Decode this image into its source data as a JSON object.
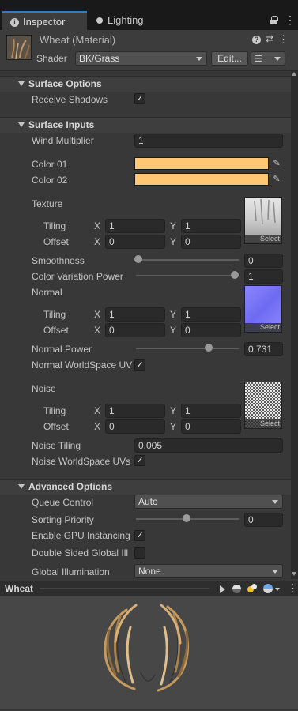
{
  "tabs": {
    "inspector": "Inspector",
    "lighting": "Lighting"
  },
  "header": {
    "title": "Wheat (Material)",
    "shader_label": "Shader",
    "shader_value": "BK/Grass",
    "edit_label": "Edit..."
  },
  "sections": {
    "surface_options": "Surface Options",
    "surface_inputs": "Surface Inputs",
    "advanced_options": "Advanced Options"
  },
  "props": {
    "receive_shadows": "Receive Shadows",
    "receive_shadows_check": "✓",
    "wind_multiplier": "Wind Multiplier",
    "wind_multiplier_value": "1",
    "color01": "Color 01",
    "color02": "Color 02",
    "color_value": "#FFC773",
    "texture": "Texture",
    "tiling": "Tiling",
    "offset": "Offset",
    "x": "X",
    "y": "Y",
    "tex_tiling_x": "1",
    "tex_tiling_y": "1",
    "tex_offset_x": "0",
    "tex_offset_y": "0",
    "smoothness": "Smoothness",
    "smoothness_value": "0",
    "color_variation": "Color Variation Power",
    "color_variation_value": "1",
    "normal": "Normal",
    "normal_tiling_x": "1",
    "normal_tiling_y": "1",
    "normal_offset_x": "0",
    "normal_offset_y": "0",
    "normal_power": "Normal Power",
    "normal_power_value": "0.731",
    "normal_worldspace": "Normal WorldSpace UV",
    "normal_worldspace_check": "✓",
    "noise": "Noise",
    "noise_tiling_x": "1",
    "noise_tiling_y": "1",
    "noise_offset_x": "0",
    "noise_offset_y": "0",
    "noise_tiling": "Noise Tiling",
    "noise_tiling_value": "0.005",
    "noise_worldspace": "Noise WorldSpace UVs",
    "noise_worldspace_check": "✓",
    "select": "Select",
    "queue_control": "Queue Control",
    "queue_control_value": "Auto",
    "sorting_priority": "Sorting Priority",
    "sorting_priority_value": "0",
    "gpu_instancing": "Enable GPU Instancing",
    "gpu_instancing_check": "✓",
    "double_sided": "Double Sided Global Ill",
    "global_illumination": "Global Illumination",
    "global_illumination_value": "None"
  },
  "preview": {
    "title": "Wheat"
  }
}
